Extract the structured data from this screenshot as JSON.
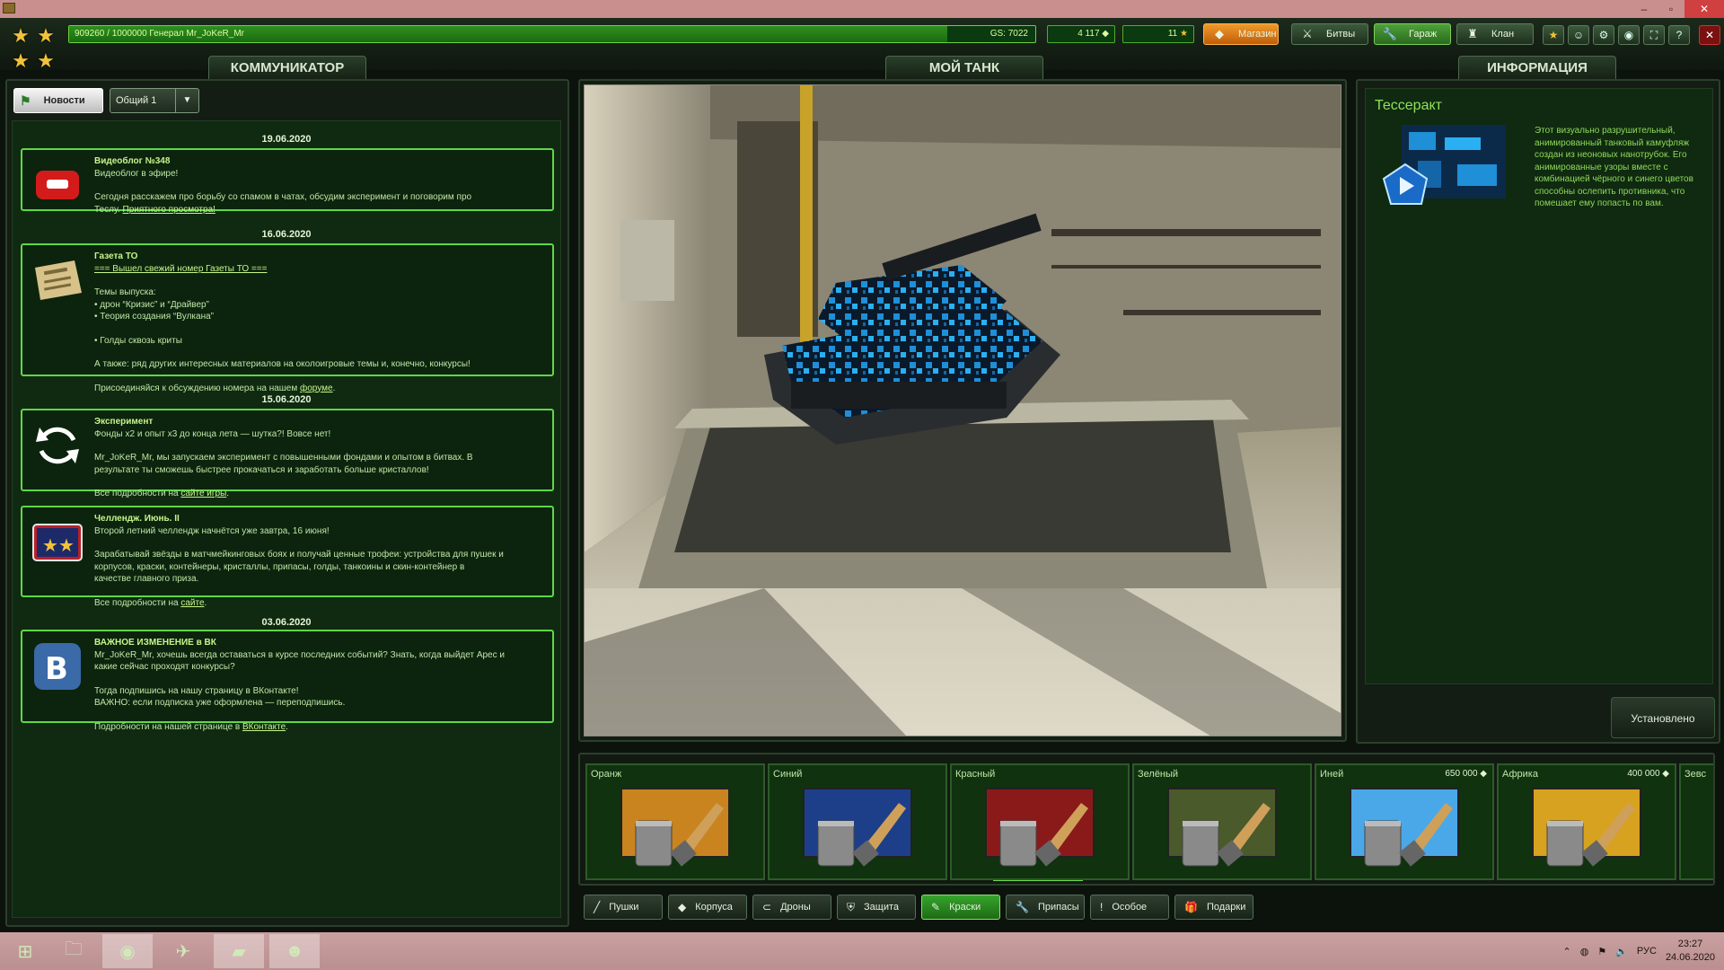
{
  "titlebar": {
    "controls": [
      "minimize-icon",
      "maximize-icon",
      "close-icon"
    ]
  },
  "topbar": {
    "xp_text": "909260 / 1000000  Генерал Mr_JoKeR_Mr",
    "xp_progress": 0.9093,
    "gs": "GS: 7022",
    "crystals": "4 117",
    "stars": "11",
    "nav": {
      "shop": "Магазин",
      "battles": "Битвы",
      "garage": "Гараж",
      "clan": "Клан"
    }
  },
  "left": {
    "tab": "КОММУНИКАТОР",
    "news_button": "Новости",
    "channel": "Общий 1",
    "feed": [
      {
        "date": "19.06.2020",
        "title": "Видеоблог №348",
        "thumb": "youtube-icon",
        "lines": [
          "Видеоблог в эфире!",
          "",
          "Сегодня расскажем про борьбу со спамом в чатах, обсудим эксперимент и поговорим про"
        ],
        "link_prefix": "Теслу. ",
        "link": "Приятного просмотра!"
      },
      {
        "date": "16.06.2020",
        "title": "Газета ТО",
        "thumb": "newspaper-icon",
        "link_top": "=== Вышел свежий номер Газеты ТО ===",
        "lines": [
          "",
          "Темы выпуска:",
          "• дрон “Кризис” и “Драйвер”",
          "• Теория создания “Вулкана”",
          "",
          "• Голды сквозь криты",
          "",
          "А также: ряд других интересных материалов на околоигровые темы и, конечно, конкурсы!",
          ""
        ],
        "link_prefix": "Присоединяйся к обсуждению номера на нашем ",
        "link": "форуме",
        "link_suffix": "."
      },
      {
        "date": "15.06.2020",
        "title": "Эксперимент",
        "thumb": "refresh-icon",
        "lines": [
          "Фонды х2 и опыт х3 до конца лета — шутка?! Вовсе нет!",
          "",
          "Mr_JoKeR_Mr, мы запускаем эксперимент с повышенными фондами и опытом в битвах. В",
          "результате ты сможешь быстрее прокачаться и заработать больше кристаллов!",
          ""
        ],
        "link_prefix": "Все подробности на ",
        "link": "сайте игры",
        "link_suffix": "."
      },
      {
        "date": "",
        "title": "Челлендж. Июнь. II",
        "thumb": "challenge-icon",
        "lines": [
          "Второй летний челлендж начнётся уже завтра, 16 июня!",
          "",
          "Зарабатывай звёзды в матчмейкинговых боях и получай ценные трофеи: устройства для пушек и",
          "корпусов, краски, контейнеры, кристаллы, припасы, голды, танкоины и скин-контейнер в",
          "качестве главного приза.",
          ""
        ],
        "link_prefix": "Все подробности на  ",
        "link": "сайте",
        "link_suffix": "."
      },
      {
        "date": "03.06.2020",
        "title": "ВАЖНОЕ ИЗМЕНЕНИЕ в ВК",
        "thumb": "vk-icon",
        "lines": [
          "Mr_JoKeR_Mr, хочешь всегда оставаться в курсе последних событий? Знать, когда выйдет Арес и",
          "какие сейчас проходят конкурсы?",
          "",
          "Тогда подпишись на нашу страницу в ВКонтакте!",
          "ВАЖНО: если подписка уже оформлена — переподпишись.",
          ""
        ],
        "link_prefix": "Подробности на нашей странице в ",
        "link": "ВКонтакте",
        "link_suffix": "."
      }
    ]
  },
  "center": {
    "tab": "МОЙ ТАНК",
    "viewport": "tank-3d-view"
  },
  "right": {
    "tab": "ИНФОРМАЦИЯ",
    "title": "Тессеракт",
    "desc": "Этот визуально разрушительный, анимированный танковый камуфляж создан из неоновых нанотрубок. Его анимированные узоры вместе с комбинацией чёрного и синего цветов способны ослепить противника, что помешает ему попасть по вам.",
    "status": "Установлено"
  },
  "paints": [
    {
      "name": "Оранж",
      "price": "",
      "color": "#c9841f"
    },
    {
      "name": "Синий",
      "price": "",
      "color": "#1d3f8a"
    },
    {
      "name": "Красный",
      "price": "",
      "color": "#8a1a1a"
    },
    {
      "name": "Зелёный",
      "price": "",
      "color": "#4a5a2a"
    },
    {
      "name": "Иней",
      "price": "650 000",
      "color": "#4aa8e8"
    },
    {
      "name": "Африка",
      "price": "400 000",
      "color": "#d7a21f"
    },
    {
      "name": "Зевс",
      "price": "",
      "color": "#444"
    }
  ],
  "tabs": [
    {
      "label": "Пушки",
      "icon": "cannon-icon"
    },
    {
      "label": "Корпуса",
      "icon": "hull-icon"
    },
    {
      "label": "Дроны",
      "icon": "drone-icon"
    },
    {
      "label": "Защита",
      "icon": "shield-icon"
    },
    {
      "label": "Краски",
      "icon": "brush-icon"
    },
    {
      "label": "Припасы",
      "icon": "wrench-icon"
    },
    {
      "label": "Особое",
      "icon": "exclamation-icon"
    },
    {
      "label": "Подарки",
      "icon": "gift-icon"
    }
  ],
  "taskbar": {
    "lang": "РУС",
    "time": "23:27",
    "date": "24.06.2020"
  }
}
